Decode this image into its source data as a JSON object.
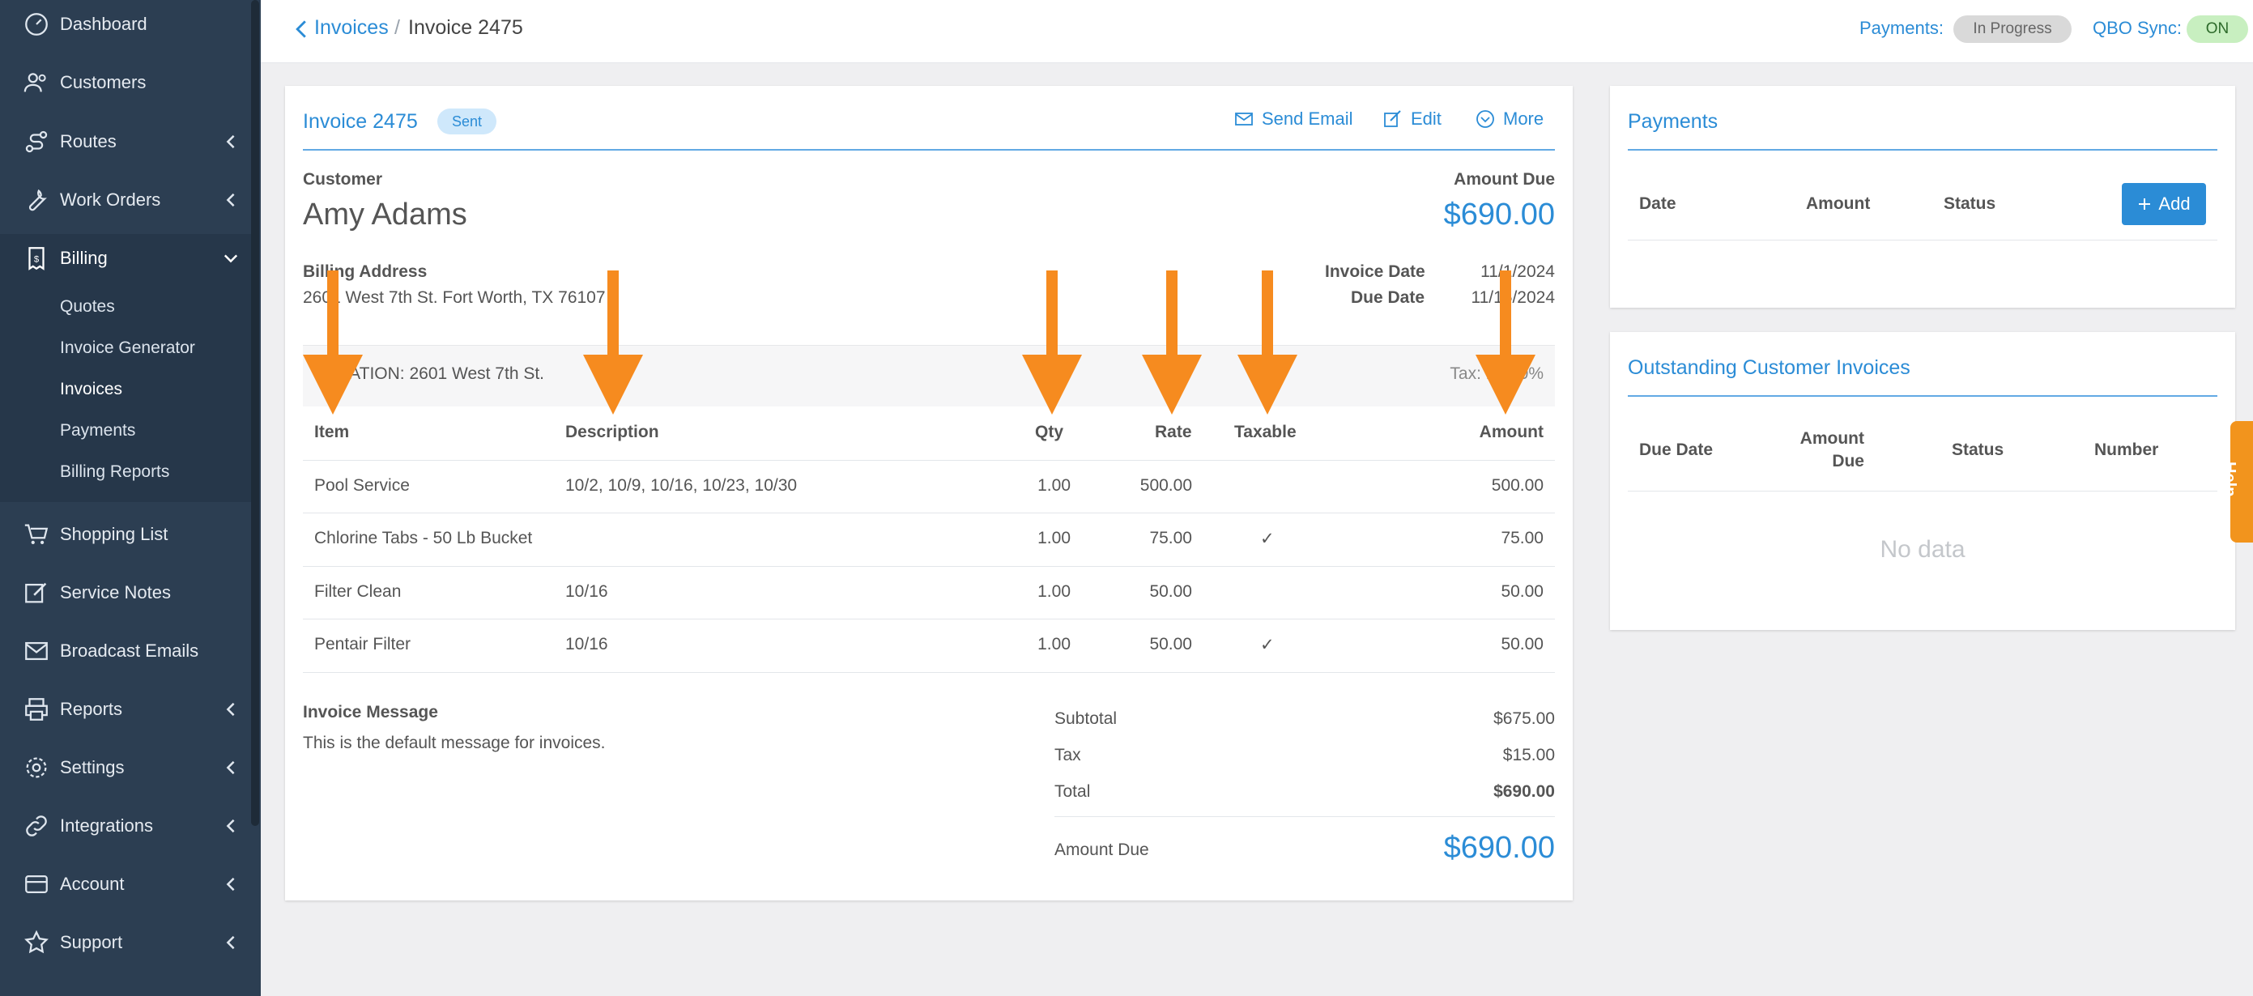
{
  "sidebar": {
    "items": [
      {
        "label": "Dashboard",
        "icon": "dashboard-icon"
      },
      {
        "label": "Customers",
        "icon": "customers-icon"
      },
      {
        "label": "Routes",
        "icon": "routes-icon"
      },
      {
        "label": "Work Orders",
        "icon": "wrench-icon"
      },
      {
        "label": "Billing",
        "icon": "billing-icon"
      },
      {
        "label": "Shopping List",
        "icon": "cart-icon"
      },
      {
        "label": "Service Notes",
        "icon": "edit-icon"
      },
      {
        "label": "Broadcast Emails",
        "icon": "mail-icon"
      },
      {
        "label": "Reports",
        "icon": "printer-icon"
      },
      {
        "label": "Settings",
        "icon": "gear-icon"
      },
      {
        "label": "Integrations",
        "icon": "link-icon"
      },
      {
        "label": "Account",
        "icon": "card-icon"
      },
      {
        "label": "Support",
        "icon": "star-icon"
      }
    ],
    "billing_sub": [
      "Quotes",
      "Invoice Generator",
      "Invoices",
      "Payments",
      "Billing Reports"
    ]
  },
  "header": {
    "breadcrumb_link": "Invoices",
    "breadcrumb_sep": "/",
    "breadcrumb_current": "Invoice 2475",
    "payments_label": "Payments:",
    "payments_status": "In Progress",
    "qbo_label": "QBO Sync:",
    "qbo_status": "ON"
  },
  "invoice": {
    "title": "Invoice 2475",
    "status": "Sent",
    "actions": {
      "send_email": "Send Email",
      "edit": "Edit",
      "more": "More"
    },
    "customer_label": "Customer",
    "customer_name": "Amy Adams",
    "amount_due_label": "Amount Due",
    "amount_due": "$690.00",
    "billing_address_label": "Billing Address",
    "billing_address": "2601 West 7th St. Fort Worth, TX 76107",
    "invoice_date_label": "Invoice Date",
    "invoice_date": "11/1/2024",
    "due_date_label": "Due Date",
    "due_date": "11/15/2024",
    "location": "LOCATION: 2601 West 7th St.",
    "tax": "Tax: 12.00%",
    "columns": {
      "item": "Item",
      "description": "Description",
      "qty": "Qty",
      "rate": "Rate",
      "taxable": "Taxable",
      "amount": "Amount"
    },
    "rows": [
      {
        "item": "Pool Service",
        "description": "10/2, 10/9, 10/16, 10/23, 10/30",
        "qty": "1.00",
        "rate": "500.00",
        "taxable": "",
        "amount": "500.00"
      },
      {
        "item": "Chlorine Tabs - 50 Lb Bucket",
        "description": "",
        "qty": "1.00",
        "rate": "75.00",
        "taxable": "✓",
        "amount": "75.00"
      },
      {
        "item": "Filter Clean",
        "description": "10/16",
        "qty": "1.00",
        "rate": "50.00",
        "taxable": "",
        "amount": "50.00"
      },
      {
        "item": "Pentair Filter",
        "description": "10/16",
        "qty": "1.00",
        "rate": "50.00",
        "taxable": "✓",
        "amount": "50.00"
      }
    ],
    "message_label": "Invoice Message",
    "message": "This is the default message for invoices.",
    "subtotal_label": "Subtotal",
    "subtotal": "$675.00",
    "tax_label": "Tax",
    "tax_amount": "$15.00",
    "total_label": "Total",
    "total": "$690.00",
    "footer_due_label": "Amount Due",
    "footer_due": "$690.00"
  },
  "payments": {
    "title": "Payments",
    "columns": [
      "Date",
      "Amount",
      "Status"
    ],
    "add_label": "Add"
  },
  "outstanding": {
    "title": "Outstanding Customer Invoices",
    "columns": [
      "Due Date",
      "Amount\nDue",
      "Status",
      "Number"
    ],
    "col_amount_line1": "Amount",
    "col_amount_line2": "Due",
    "empty": "No data"
  },
  "help": {
    "label": "Help"
  },
  "colors": {
    "accent": "#2b8cd6",
    "sidebar": "#2c3e52",
    "arrow": "#f68b1f",
    "sync_on": "#c8efc0"
  }
}
